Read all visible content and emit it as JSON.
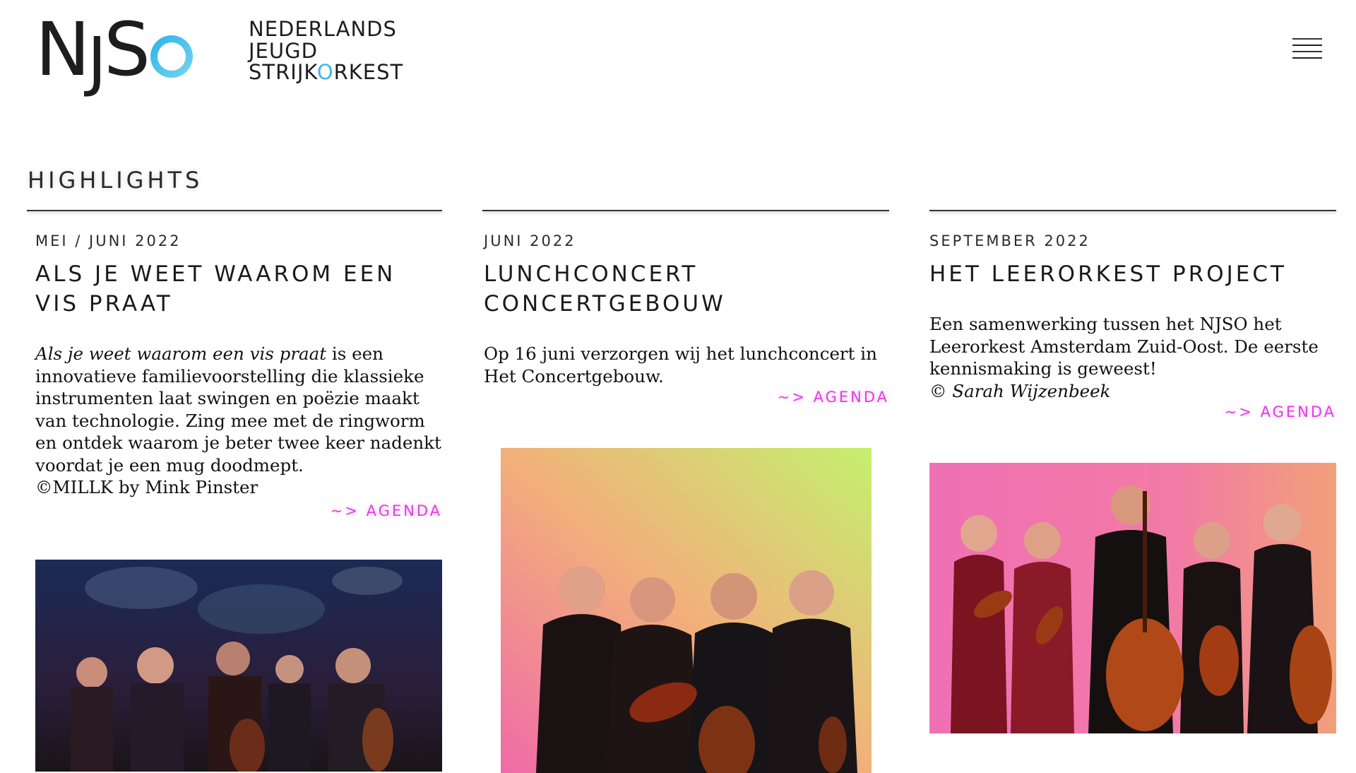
{
  "header": {
    "logo_letters": "NJS",
    "logo_name_line1": "NEDERLANDS",
    "logo_name_line2": "JEUGD",
    "logo_name_line3_a": "STRIJK",
    "logo_name_line3_o": "O",
    "logo_name_line3_b": "RKEST",
    "menu_icon": "hamburger-menu-icon"
  },
  "section": {
    "title": "HIGHLIGHTS"
  },
  "cards": [
    {
      "date": "MEI / JUNI 2022",
      "title": "ALS JE WEET WAAROM EEN VIS PRAAT",
      "desc_italic": "Als je weet waarom een vis praat",
      "desc_rest": " is een innovatieve familievoorstelling die klassieke instrumenten laat swingen en poëzie maakt van technologie. Zing mee met de ringworm en ontdek waarom je beter twee keer nadenkt voordat je een mug doodmept.",
      "credit": "©MILLK by Mink Pinster",
      "link": "~> AGENDA"
    },
    {
      "date": "JUNI 2022",
      "title": "LUNCHCONCERT CONCERTGEBOUW",
      "desc": "Op 16 juni verzorgen wij het lunchconcert in Het Concertgebouw.",
      "link": "~> AGENDA"
    },
    {
      "date": "SEPTEMBER 2022",
      "title": "HET LEERORKEST PROJECT",
      "desc": "Een samenwerking tussen het NJSO het Leerorkest Amsterdam Zuid-Oost. De eerste kennismaking is geweest!",
      "credit_prefix": "© ",
      "credit_italic": "Sarah Wijzenbeek",
      "link": "~> AGENDA"
    }
  ],
  "colors": {
    "accent_magenta": "#e23fe0",
    "logo_blue": "#3db6e4",
    "text": "#1a1a1a"
  }
}
